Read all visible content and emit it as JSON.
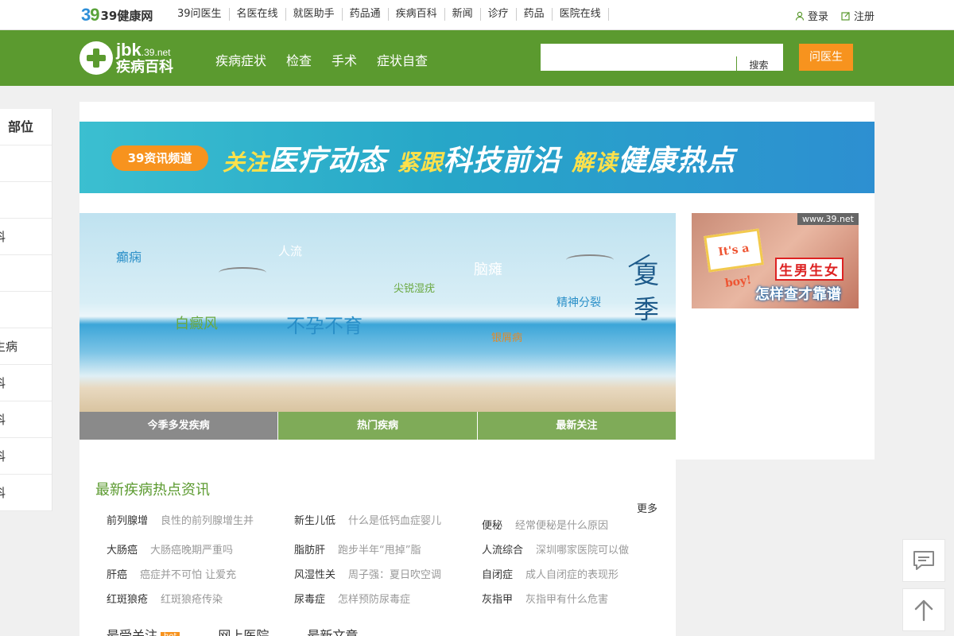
{
  "topbar": {
    "logo_mark": "39",
    "logo_text": "39健康网",
    "nav": [
      "39问医生",
      "名医在线",
      "就医助手",
      "药品通",
      "疾病百科",
      "新闻",
      "诊疗",
      "药品",
      "医院在线"
    ],
    "login": "登录",
    "register": "注册"
  },
  "header": {
    "logo_en": "jbk",
    "logo_domain": ".39.net",
    "logo_cn": "疾病百科",
    "nav": [
      "疾病症状",
      "检查",
      "手术",
      "症状自查"
    ],
    "search_button": "搜索",
    "search_placeholder": "",
    "ask_button": "问医生"
  },
  "sidebar": {
    "title": "部位",
    "rows": [
      "",
      "",
      "科",
      "",
      "",
      "生病",
      "科",
      "科",
      "科",
      "科"
    ]
  },
  "banner": {
    "pill": "39资讯频道",
    "s1a": "关注",
    "s1b": "医疗动态",
    "s2a": "紧跟",
    "s2b": "科技前沿",
    "s3a": "解读",
    "s3b": "健康热点"
  },
  "hero": {
    "tags": [
      "癫痫",
      "人流",
      "脑瘫",
      "尖锐湿疣",
      "精神分裂",
      "白癜风",
      "不孕不育",
      "银屑病"
    ],
    "season": [
      "夏",
      "季"
    ],
    "tabs": [
      "今季多发疾病",
      "热门疾病",
      "最新关注"
    ]
  },
  "ad": {
    "url": "www.39.net",
    "sign": "It's a boy!",
    "line1": "生男生女",
    "line2": "怎样查才靠谱"
  },
  "news": {
    "title": "最新疾病热点资讯",
    "more": "更多",
    "items": [
      {
        "k": "前列腺增",
        "d": "良性的前列腺增生并"
      },
      {
        "k": "新生儿低",
        "d": "什么是低钙血症婴儿"
      },
      {
        "k": "便秘",
        "d": "经常便秘是什么原因"
      },
      {
        "k": "大肠癌",
        "d": "大肠癌晚期严重吗"
      },
      {
        "k": "脂肪肝",
        "d": "跑步半年“甩掉”脂"
      },
      {
        "k": "人流综合",
        "d": "深圳哪家医院可以做"
      },
      {
        "k": "肝癌",
        "d": "癌症并不可怕 让爱充"
      },
      {
        "k": "风湿性关",
        "d": "周子强：夏日吹空调"
      },
      {
        "k": "自闭症",
        "d": "成人自闭症的表现形"
      },
      {
        "k": "红斑狼疮",
        "d": "红斑狼疮传染"
      },
      {
        "k": "尿毒症",
        "d": "怎样预防尿毒症"
      },
      {
        "k": "灰指甲",
        "d": "灰指甲有什么危害"
      }
    ],
    "subtabs": [
      "最受关注",
      "网上医院",
      "最新文章"
    ],
    "hot_badge": "hot"
  }
}
